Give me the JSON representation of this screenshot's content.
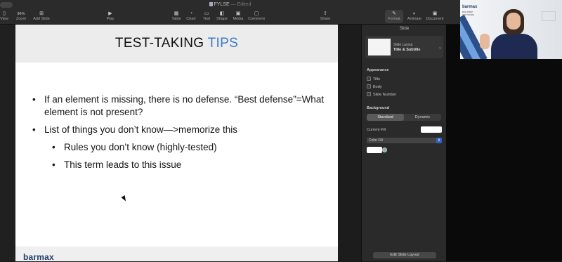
{
  "window": {
    "document_name": "FYLSE",
    "status": "— Edited"
  },
  "toolbar": {
    "items": [
      {
        "label": "View",
        "icon": "sidebar-icon"
      },
      {
        "label": "Zoom",
        "value": "96%",
        "icon": "zoom-icon"
      },
      {
        "label": "Add Slide",
        "icon": "plus-icon"
      },
      {
        "label": "Play",
        "icon": "play-icon"
      },
      {
        "label": "Table",
        "icon": "table-icon"
      },
      {
        "label": "Chart",
        "icon": "chart-icon"
      },
      {
        "label": "Text",
        "icon": "text-icon"
      },
      {
        "label": "Shape",
        "icon": "shape-icon"
      },
      {
        "label": "Media",
        "icon": "media-icon"
      },
      {
        "label": "Comment",
        "icon": "comment-icon"
      },
      {
        "label": "Share",
        "icon": "share-icon"
      },
      {
        "label": "Format",
        "icon": "paintbrush-icon"
      },
      {
        "label": "Animate",
        "icon": "animate-icon"
      },
      {
        "label": "Document",
        "icon": "document-icon"
      }
    ]
  },
  "slide": {
    "title_main": "TEST-TAKING ",
    "title_accent": "TIPS",
    "bullets": [
      {
        "text": "If an element is missing, there is no defense.  “Best defense”=What element is not present?",
        "level": 1
      },
      {
        "text": "List of things you don’t know—>memorize this",
        "level": 1
      },
      {
        "text": "Rules you don’t know (highly-tested)",
        "level": 2
      },
      {
        "text": "This term leads to this issue",
        "level": 2
      }
    ],
    "footer_logo": "barmax"
  },
  "inspector": {
    "tab": "Slide",
    "layout_label": "Slide Layout",
    "layout_value": "Title & Subtitle",
    "appearance_label": "Appearance",
    "checks": [
      "Title",
      "Body",
      "Slide Number"
    ],
    "background_label": "Background",
    "seg_standard": "Standard",
    "seg_dynamic": "Dynamic",
    "current_fill_label": "Current Fill",
    "fill_type": "Color Fill",
    "edit_layout_button": "Edit Slide Layout"
  },
  "video": {
    "brand": "barmax",
    "brand_sub": "BAR PREP SOFTWARE"
  },
  "colors": {
    "accent": "#3c7ec0",
    "brand": "#1f3d6b"
  }
}
